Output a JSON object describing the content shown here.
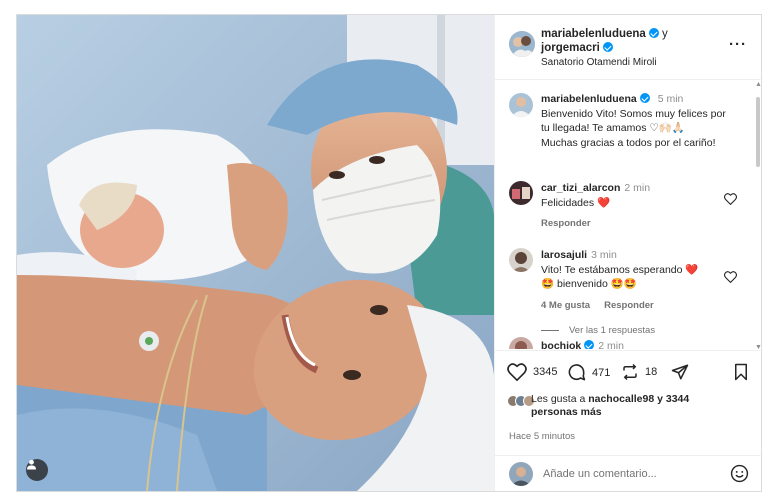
{
  "post": {
    "author1": "mariabelenluduena",
    "connector": "y",
    "author2": "jorgemacri",
    "location": "Sanatorio Otamendi Miroli",
    "more_icon": "more-horizontal-icon"
  },
  "caption": {
    "user": "mariabelenluduena",
    "time": "5 min",
    "line1": "Bienvenido Vito! Somos muy felices por",
    "line2": "tu llegada! Te amamos ♡🙌🏻🙏🏻",
    "line3": "Muchas gracias a todos por el cariño!"
  },
  "comments": [
    {
      "user": "car_tizi_alarcon",
      "time": "2 min",
      "text": "Felicidades ❤️",
      "reply": "Responder",
      "likes": ""
    },
    {
      "user": "larosajuli",
      "time": "3 min",
      "text1": "Vito! Te estábamos esperando ❤️",
      "text2": "🤩 bienvenido 🤩🤩",
      "likes": "4 Me gusta",
      "reply": "Responder",
      "view_replies": "Ver las 1 respuestas"
    },
    {
      "user": "bochiok",
      "time": "2 min"
    }
  ],
  "actions": {
    "like_count": "3345",
    "comment_count": "471",
    "repost_count": "18"
  },
  "likes_summary": {
    "prefix": "Les gusta a",
    "user": "nachocalle98",
    "middle": "y 3344",
    "suffix": "personas más"
  },
  "timestamp": "Hace 5 minutos",
  "add_comment": {
    "placeholder": "Añade un comentario..."
  },
  "colors": {
    "verified": "#0095f6",
    "heart": "#ed4956",
    "border": "#dbdbdb"
  }
}
